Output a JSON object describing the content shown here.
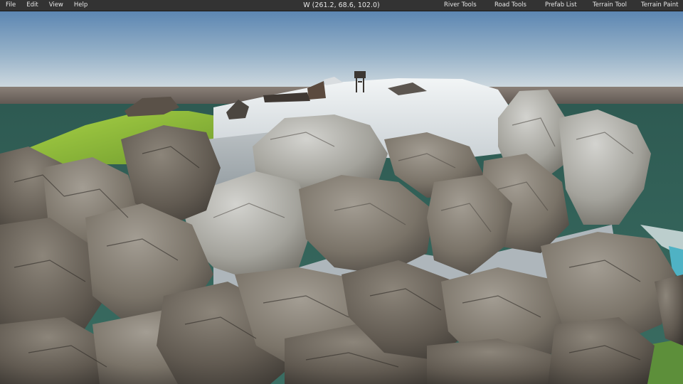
{
  "menu": {
    "file": "File",
    "edit": "Edit",
    "view": "View",
    "help": "Help"
  },
  "status": {
    "world_coords": "W (261.2, 68.6, 102.0)"
  },
  "tools": {
    "river": "River Tools",
    "road": "Road Tools",
    "prefab": "Prefab List",
    "terrain_tool": "Terrain Tool",
    "terrain_paint": "Terrain Paint"
  },
  "colors": {
    "menubar_bg": "#333333",
    "menubar_text": "#e6e6e6",
    "sky_top": "#5e86b0",
    "sky_horizon": "#c9d6e0",
    "water": "#2f5f55",
    "grass": "#8fc13a",
    "snow": "#e8eef0",
    "rock_dark": "#4f4a44",
    "rock_mid": "#7b7468",
    "rock_light": "#c7c8c4"
  }
}
